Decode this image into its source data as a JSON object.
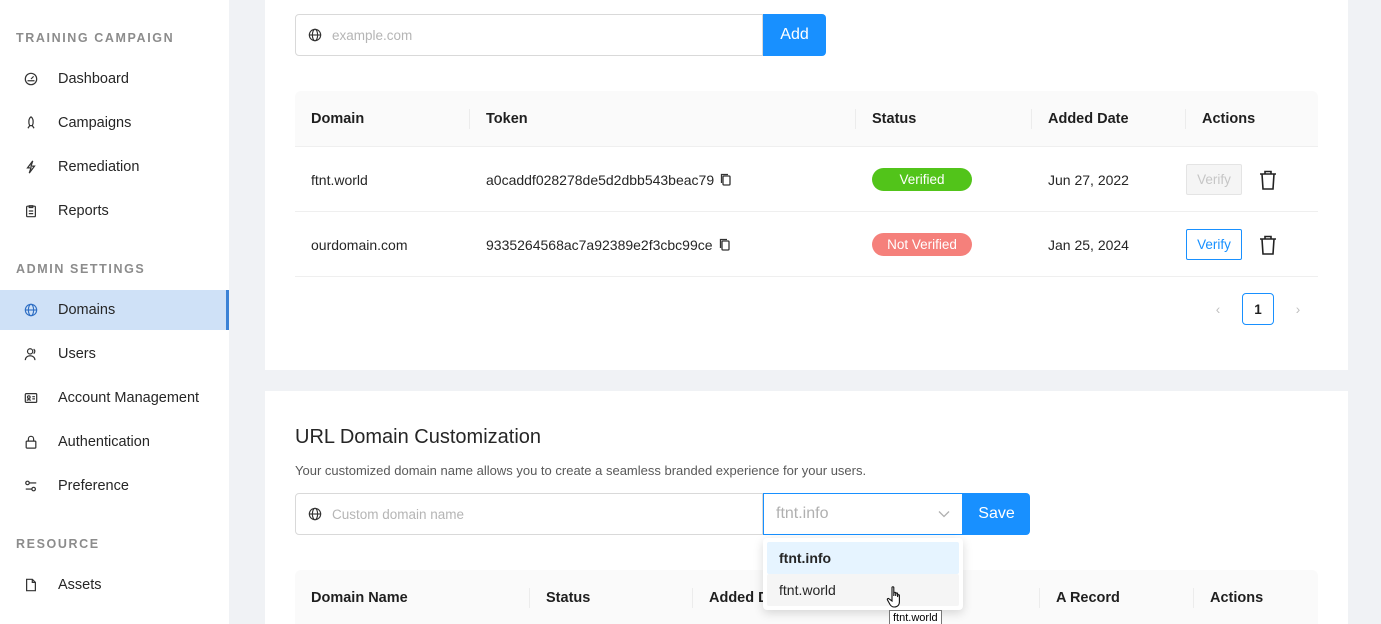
{
  "sidebar": {
    "sections": [
      {
        "title": "TRAINING CAMPAIGN"
      },
      {
        "title": "ADMIN SETTINGS"
      },
      {
        "title": "RESOURCE"
      }
    ],
    "items": [
      {
        "label": "Dashboard",
        "icon": "dashboard-icon"
      },
      {
        "label": "Campaigns",
        "icon": "rocket-icon"
      },
      {
        "label": "Remediation",
        "icon": "lightning-icon"
      },
      {
        "label": "Reports",
        "icon": "clipboard-icon"
      },
      {
        "label": "Domains",
        "icon": "globe-icon",
        "active": true
      },
      {
        "label": "Users",
        "icon": "users-icon"
      },
      {
        "label": "Account Management",
        "icon": "id-card-icon"
      },
      {
        "label": "Authentication",
        "icon": "lock-icon"
      },
      {
        "label": "Preference",
        "icon": "sliders-icon"
      },
      {
        "label": "Assets",
        "icon": "file-icon"
      }
    ]
  },
  "domains": {
    "input_placeholder": "example.com",
    "add_label": "Add",
    "columns": [
      "Domain",
      "Token",
      "Status",
      "Added Date",
      "Actions"
    ],
    "rows": [
      {
        "domain": "ftnt.world",
        "token": "a0caddf028278de5d2dbb543beac79",
        "status": "Verified",
        "date": "Jun 27, 2022",
        "verify": "Verify"
      },
      {
        "domain": "ourdomain.com",
        "token": "9335264568ac7a92389e2f3cbc99ce",
        "status": "Not Verified",
        "date": "Jan 25, 2024",
        "verify": "Verify"
      }
    ],
    "pagination": {
      "prev": "‹",
      "current": "1",
      "next": "›"
    }
  },
  "url_custom": {
    "title": "URL Domain Customization",
    "description": "Your customized domain name allows you to create a seamless branded experience for your users.",
    "input_placeholder": "Custom domain name",
    "selected": "ftnt.info",
    "save_label": "Save",
    "options": [
      "ftnt.info",
      "ftnt.world"
    ],
    "columns": [
      "Domain Name",
      "Status",
      "Added D",
      "A Record",
      "Actions"
    ],
    "tooltip": "ftnt.world"
  },
  "colors": {
    "primary": "#1890ff",
    "verified": "#52c41a",
    "not_verified": "#f5807b",
    "active_nav_bg": "#cfe1f7"
  }
}
